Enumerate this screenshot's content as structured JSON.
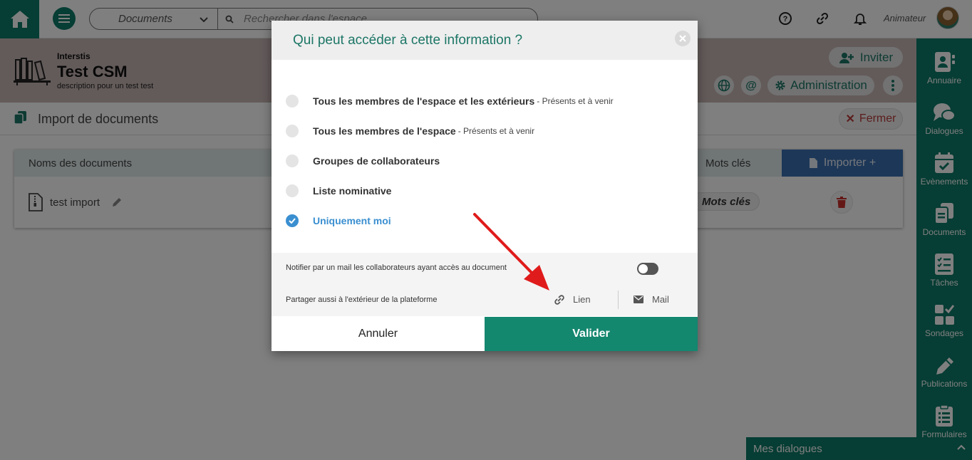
{
  "topbar": {
    "search_scope": "Documents",
    "search_placeholder": "Rechercher dans l'espace",
    "role": "Animateur"
  },
  "space": {
    "organization": "Interstis",
    "title": "Test CSM",
    "description": "description pour un test test",
    "invite_label": "Inviter",
    "admin_label": "Administration"
  },
  "page": {
    "title": "Import de documents",
    "close_label": "Fermer"
  },
  "table": {
    "col_names": "Noms des documents",
    "col_keywords": "Mots clés",
    "import_label": "Importer +",
    "rows": [
      {
        "name": "test import",
        "tag": "Mots clés"
      }
    ]
  },
  "sidebar": {
    "items": [
      {
        "label": "Annuaire",
        "icon": "contacts-icon"
      },
      {
        "label": "Dialogues",
        "icon": "chat-icon"
      },
      {
        "label": "Evènements",
        "icon": "calendar-icon"
      },
      {
        "label": "Documents",
        "icon": "documents-icon"
      },
      {
        "label": "Tâches",
        "icon": "tasks-icon"
      },
      {
        "label": "Sondages",
        "icon": "poll-icon"
      },
      {
        "label": "Publications",
        "icon": "pen-icon"
      },
      {
        "label": "Formulaires",
        "icon": "form-icon"
      }
    ]
  },
  "dialogs_bar": {
    "label": "Mes dialogues"
  },
  "modal": {
    "title": "Qui peut accéder à cette information ?",
    "options": [
      {
        "label": "Tous les membres de l'espace et les extérieurs",
        "sub": "- Présents et à venir",
        "selected": false
      },
      {
        "label": "Tous les membres de l'espace",
        "sub": "- Présents et à venir",
        "selected": false
      },
      {
        "label": "Groupes de collaborateurs",
        "sub": "",
        "selected": false
      },
      {
        "label": "Liste nominative",
        "sub": "",
        "selected": false
      },
      {
        "label": "Uniquement moi",
        "sub": "",
        "selected": true
      }
    ],
    "notify_text": "Notifier par un mail les collaborateurs ayant accès au document",
    "notify_enabled": false,
    "share_text": "Partager aussi à l'extérieur de la plateforme",
    "share_link_label": "Lien",
    "share_mail_label": "Mail",
    "cancel_label": "Annuler",
    "validate_label": "Valider"
  },
  "colors": {
    "brand": "#0d7a68",
    "selected_option": "#3a8fd0",
    "annotation_arrow": "#e01b1b"
  }
}
